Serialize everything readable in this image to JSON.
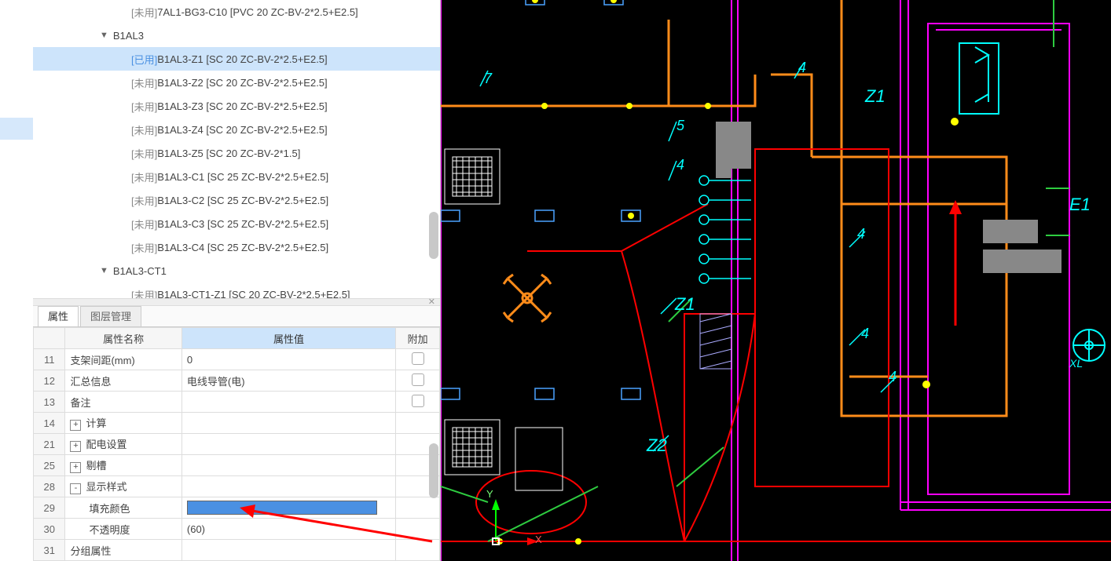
{
  "tree": {
    "items": [
      {
        "kind": "leaf",
        "tag": "[未用]",
        "label": "7AL1-BG3-C10 [PVC 20 ZC-BV-2*2.5+E2.5]",
        "used": false
      },
      {
        "kind": "group",
        "label": "B1AL3"
      },
      {
        "kind": "leaf",
        "tag": "[已用]",
        "label": "B1AL3-Z1 [SC 20 ZC-BV-2*2.5+E2.5]",
        "used": true,
        "selected": true
      },
      {
        "kind": "leaf",
        "tag": "[未用]",
        "label": "B1AL3-Z2 [SC 20 ZC-BV-2*2.5+E2.5]",
        "used": false
      },
      {
        "kind": "leaf",
        "tag": "[未用]",
        "label": "B1AL3-Z3 [SC 20 ZC-BV-2*2.5+E2.5]",
        "used": false
      },
      {
        "kind": "leaf",
        "tag": "[未用]",
        "label": "B1AL3-Z4 [SC 20 ZC-BV-2*2.5+E2.5]",
        "used": false
      },
      {
        "kind": "leaf",
        "tag": "[未用]",
        "label": "B1AL3-Z5 [SC 20 ZC-BV-2*1.5]",
        "used": false
      },
      {
        "kind": "leaf",
        "tag": "[未用]",
        "label": "B1AL3-C1 [SC 25 ZC-BV-2*2.5+E2.5]",
        "used": false
      },
      {
        "kind": "leaf",
        "tag": "[未用]",
        "label": "B1AL3-C2 [SC 25 ZC-BV-2*2.5+E2.5]",
        "used": false
      },
      {
        "kind": "leaf",
        "tag": "[未用]",
        "label": "B1AL3-C3 [SC 25 ZC-BV-2*2.5+E2.5]",
        "used": false
      },
      {
        "kind": "leaf",
        "tag": "[未用]",
        "label": "B1AL3-C4 [SC 25 ZC-BV-2*2.5+E2.5]",
        "used": false
      },
      {
        "kind": "group",
        "label": "B1AL3-CT1"
      },
      {
        "kind": "leaf",
        "tag": "[未用]",
        "label": "B1AL3-CT1-Z1 [SC 20 ZC-BV-2*2.5+E2.5]",
        "used": false
      }
    ]
  },
  "tabs": {
    "active": "属性",
    "other": "图层管理"
  },
  "grid": {
    "headers": {
      "name": "属性名称",
      "value": "属性值",
      "extra": "附加"
    },
    "rows": [
      {
        "num": "11",
        "name": "支架间距(mm)",
        "value": "0",
        "check": true
      },
      {
        "num": "12",
        "name": "汇总信息",
        "value": "电线导管(电)",
        "check": true
      },
      {
        "num": "13",
        "name": "备注",
        "value": "",
        "check": true
      },
      {
        "num": "14",
        "name": "计算",
        "expand": "+"
      },
      {
        "num": "21",
        "name": "配电设置",
        "expand": "+"
      },
      {
        "num": "25",
        "name": "剔槽",
        "expand": "+"
      },
      {
        "num": "28",
        "name": "显示样式",
        "expand": "-"
      },
      {
        "num": "29",
        "name": "填充颜色",
        "swatch": true,
        "indent": true
      },
      {
        "num": "30",
        "name": "不透明度",
        "value": "(60)",
        "indent": true
      },
      {
        "num": "31",
        "name": "分组属性"
      }
    ]
  },
  "cad_labels": {
    "l7": "7",
    "l5": "5",
    "l4a": "4",
    "l4b": "4",
    "l4c": "4",
    "l4d": "4",
    "l4e": "4",
    "z1a": "Z1",
    "z1b": "Z1",
    "z2": "Z2",
    "e1": "E1",
    "xl": "XL",
    "y": "Y",
    "x": "X"
  }
}
